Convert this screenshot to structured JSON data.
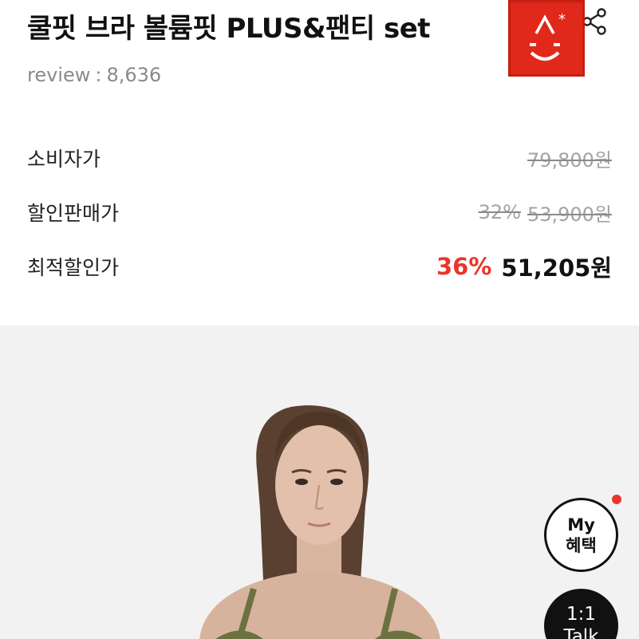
{
  "product": {
    "title": "쿨핏 브라 볼륨핏 PLUS&팬티 set",
    "review_label": "review",
    "review_sep": ":",
    "review_count": "8,636"
  },
  "prices": {
    "consumer": {
      "label": "소비자가",
      "value": "79,800원"
    },
    "sale": {
      "label": "할인판매가",
      "percent": "32%",
      "value": "53,900원"
    },
    "best": {
      "label": "최적할인가",
      "percent": "36%",
      "value": "51,205원"
    }
  },
  "floating": {
    "my_benefit_line1": "My",
    "my_benefit_line2": "혜택",
    "talk_line1": "1:1",
    "talk_line2": "Talk"
  },
  "colors": {
    "accent_red": "#e8362d",
    "brand_red": "#e0291b",
    "muted_gray": "#a3a3a3"
  },
  "icons": {
    "share": "share-icon",
    "brand_logo": "brand-logo-icon"
  }
}
